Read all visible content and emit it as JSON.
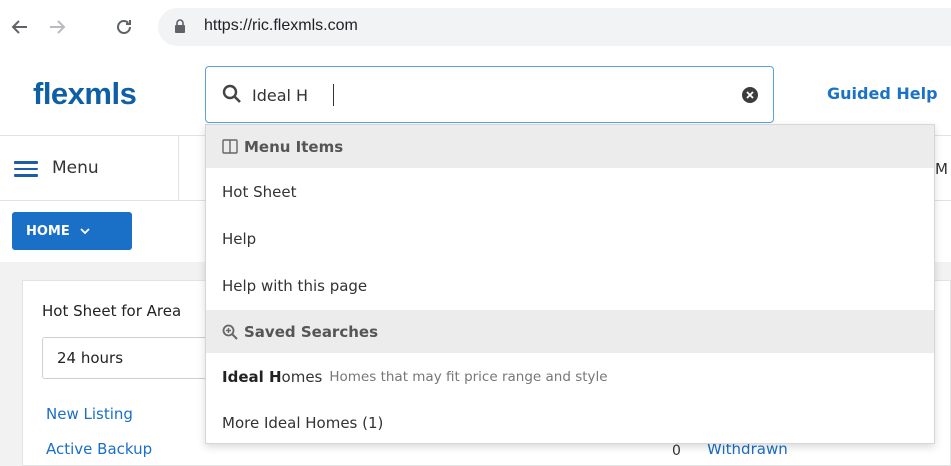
{
  "browser": {
    "url": "https://ric.flexmls.com"
  },
  "header": {
    "logo": "flexmls",
    "search_value": "Ideal H",
    "guided_help": "Guided Help"
  },
  "menubar": {
    "menu_label": "Menu",
    "right_partial": "M"
  },
  "home_button": {
    "label": "HOME"
  },
  "card": {
    "title": "Hot Sheet for Area",
    "period": "24 hours",
    "links": [
      {
        "label": "New Listing"
      },
      {
        "label": "Active Backup",
        "count": "0"
      }
    ],
    "right_link": "Withdrawn"
  },
  "dropdown": {
    "menu_items_header": "Menu Items",
    "menu_items": [
      "Hot Sheet",
      "Help",
      "Help with this page"
    ],
    "saved_searches_header": "Saved Searches",
    "saved_search": {
      "match_bold": "Ideal H",
      "match_rest": "omes",
      "description": "Homes that may fit price range and style"
    },
    "more_label": "More Ideal Homes (1)"
  }
}
